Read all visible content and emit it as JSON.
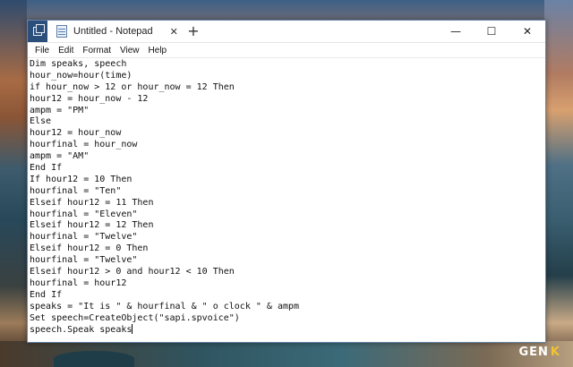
{
  "window": {
    "tab_title": "Untitled - Notepad",
    "tab_close": "✕",
    "new_tab": "+",
    "minimize": "—",
    "maximize": "☐",
    "close": "✕"
  },
  "menu": [
    "File",
    "Edit",
    "Format",
    "View",
    "Help"
  ],
  "code_lines": [
    "Dim speaks, speech",
    "hour_now=hour(time)",
    "if hour_now > 12 or hour_now = 12 Then",
    "hour12 = hour_now - 12",
    "ampm = \"PM\"",
    "Else",
    "hour12 = hour_now",
    "hourfinal = hour_now",
    "ampm = \"AM\"",
    "End If",
    "If hour12 = 10 Then",
    "hourfinal = \"Ten\"",
    "Elseif hour12 = 11 Then",
    "hourfinal = \"Eleven\"",
    "Elseif hour12 = 12 Then",
    "hourfinal = \"Twelve\"",
    "Elseif hour12 = 0 Then",
    "hourfinal = \"Twelve\"",
    "Elseif hour12 > 0 and hour12 < 10 Then",
    "hourfinal = hour12",
    "End If",
    "speaks = \"It is \" & hourfinal & \" o clock \" & ampm",
    "Set speech=CreateObject(\"sapi.spvoice\")",
    "speech.Speak speaks"
  ],
  "watermark": {
    "text_main": "GEN",
    "text_accent": "K"
  }
}
